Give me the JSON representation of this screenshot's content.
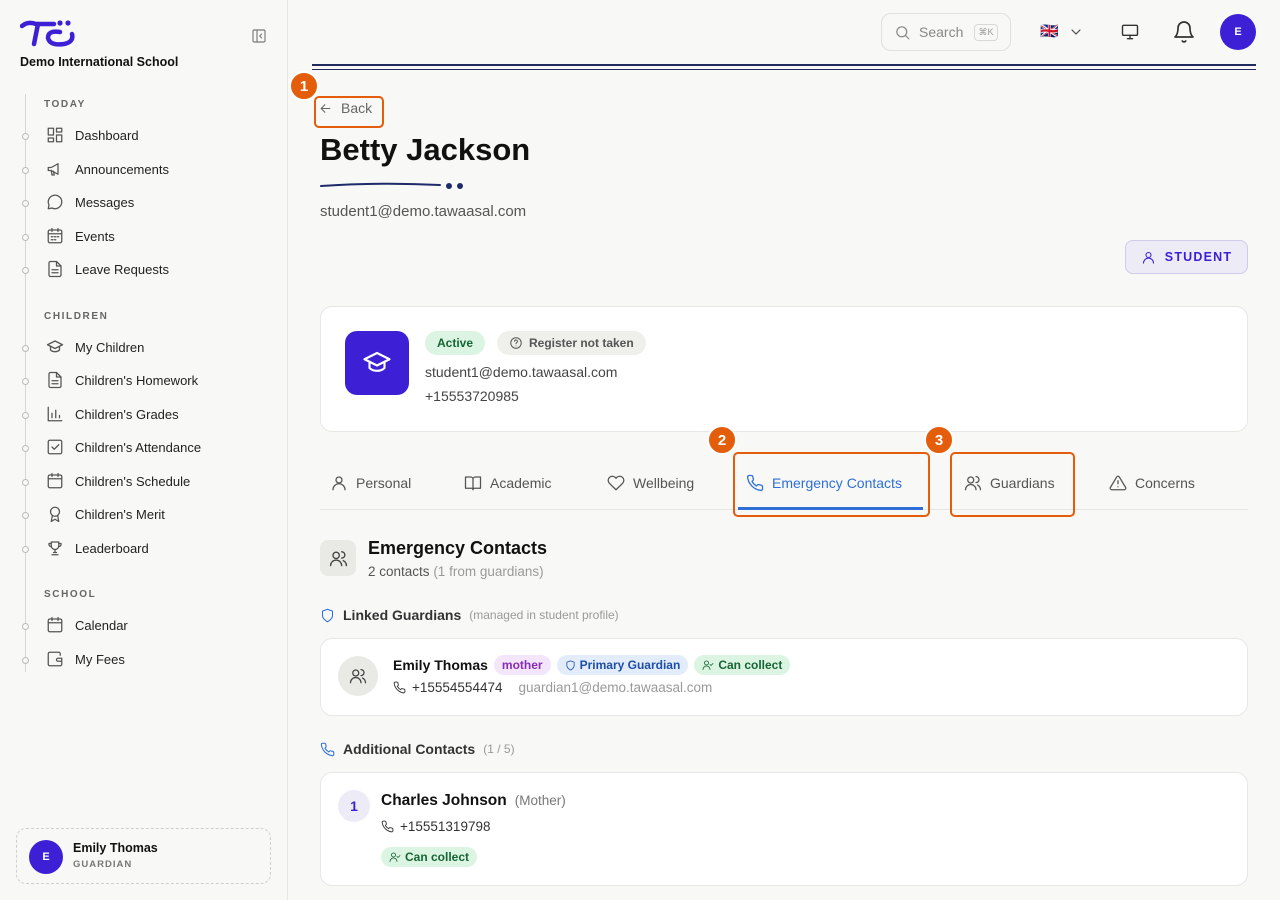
{
  "sidebar": {
    "school_name": "Demo International School",
    "sections": [
      {
        "title": "TODAY",
        "items": [
          "Dashboard",
          "Announcements",
          "Messages",
          "Events",
          "Leave Requests"
        ]
      },
      {
        "title": "CHILDREN",
        "items": [
          "My Children",
          "Children's Homework",
          "Children's Grades",
          "Children's Attendance",
          "Children's Schedule",
          "Children's Merit",
          "Leaderboard"
        ]
      },
      {
        "title": "SCHOOL",
        "items": [
          "Calendar",
          "My Fees"
        ]
      }
    ],
    "user": {
      "initial": "E",
      "name": "Emily Thomas",
      "role": "GUARDIAN"
    }
  },
  "topbar": {
    "search_placeholder": "Search",
    "search_shortcut": "⌘K",
    "language_flag": "🇬🇧",
    "user_initial": "E"
  },
  "page": {
    "back_label": "Back",
    "student_name": "Betty Jackson",
    "student_email": "student1@demo.tawaasal.com",
    "role_badge": "STUDENT"
  },
  "profile_card": {
    "status": "Active",
    "register_status": "Register not taken",
    "email": "student1@demo.tawaasal.com",
    "phone": "+15553720985"
  },
  "tabs": [
    "Personal",
    "Academic",
    "Wellbeing",
    "Emergency Contacts",
    "Guardians",
    "Concerns"
  ],
  "active_tab": "Emergency Contacts",
  "callouts": [
    "1",
    "2",
    "3"
  ],
  "emergency": {
    "title": "Emergency Contacts",
    "summary": "2 contacts",
    "summary_note": "(1 from guardians)",
    "linked_title": "Linked Guardians",
    "linked_note": "(managed in student profile)",
    "guardian": {
      "name": "Emily Thomas",
      "relation": "mother",
      "primary": "Primary Guardian",
      "collect": "Can collect",
      "phone": "+15554554474",
      "email": "guardian1@demo.tawaasal.com"
    },
    "additional_title": "Additional Contacts",
    "additional_count": "(1 / 5)",
    "contact": {
      "index": "1",
      "name": "Charles Johnson",
      "relation": "(Mother)",
      "phone": "+15551319798",
      "collect": "Can collect"
    }
  },
  "colors": {
    "accent": "#3d1fd6",
    "callout": "#e35d0a",
    "active_tab": "#2f6fd6",
    "success_bg": "#dcf5e3",
    "success_text": "#166534"
  }
}
